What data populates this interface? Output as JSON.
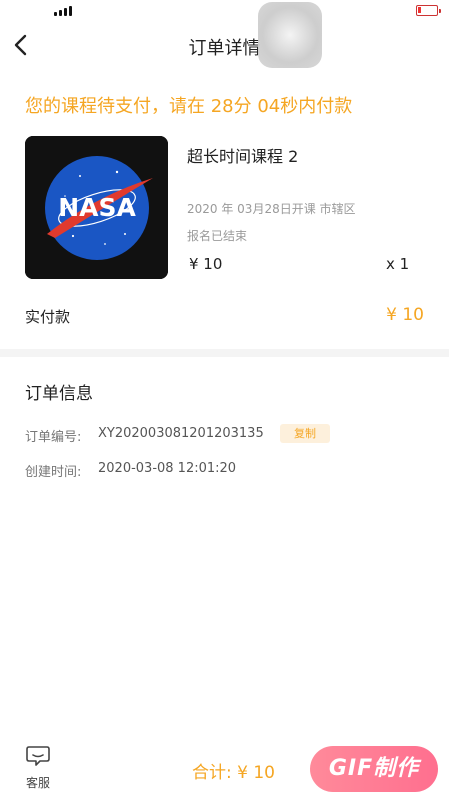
{
  "nav": {
    "title": "订单详情"
  },
  "countdown": {
    "text": "您的课程待支付，请在 28分 04秒内付款"
  },
  "course": {
    "title": "超长时间课程 2",
    "date": "2020 年 03月28日开课 市辖区",
    "status": "报名已结束",
    "price": "¥ 10",
    "quantity": "x 1",
    "cover_text": "NASA"
  },
  "payment": {
    "label": "实付款",
    "value": "¥ 10"
  },
  "order_info": {
    "heading": "订单信息",
    "number_label": "订单编号:",
    "number_value": "XY202003081201203135",
    "copy_label": "复制",
    "created_label": "创建时间:",
    "created_value": "2020-03-08 12:01:20"
  },
  "bottom": {
    "service_label": "客服",
    "total_text": "合计: ¥ 10",
    "pay_label": "GIF制作"
  },
  "icons": {
    "back": "chevron-left-icon",
    "service": "chat-bubble-icon",
    "signal": "signal-icon",
    "battery": "battery-icon"
  },
  "colors": {
    "accent": "#f5a623",
    "pay_button": "#ff6f8f"
  }
}
